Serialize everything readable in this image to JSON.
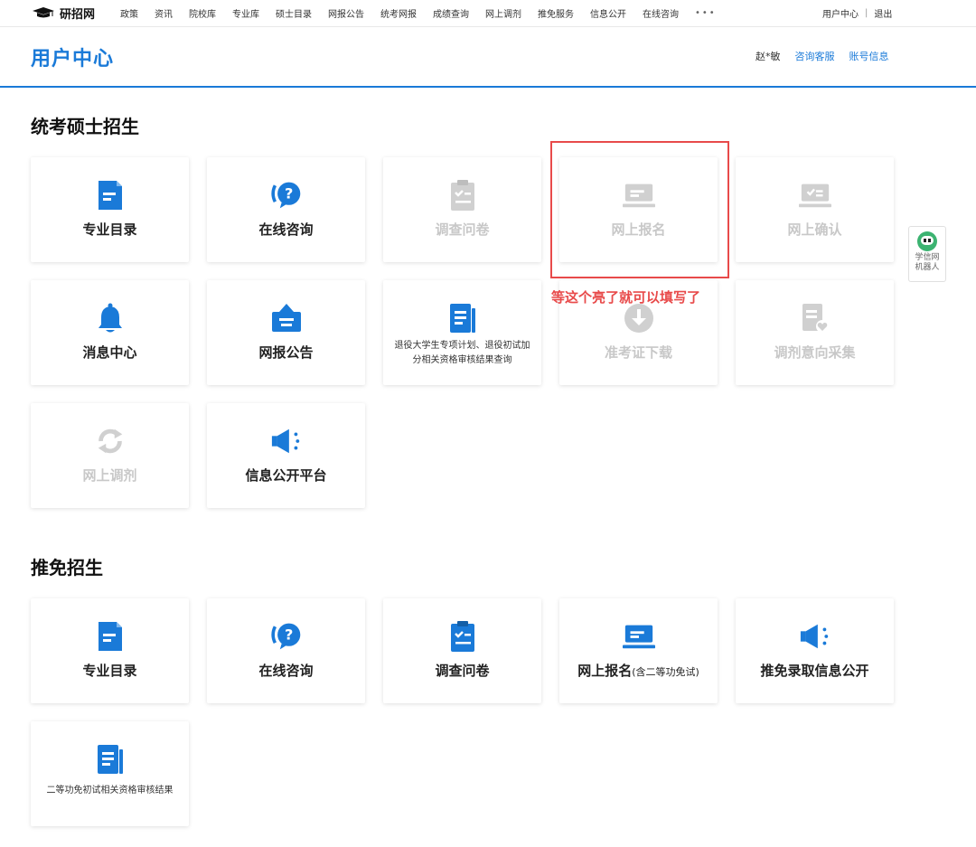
{
  "topnav": {
    "logo": "研招网",
    "items": [
      "政策",
      "资讯",
      "院校库",
      "专业库",
      "硕士目录",
      "网报公告",
      "统考网报",
      "成绩查询",
      "网上调剂",
      "推免服务",
      "信息公开",
      "在线咨询"
    ],
    "more": "•••",
    "user_center": "用户中心",
    "separator": "|",
    "logout": "退出"
  },
  "header": {
    "title": "用户中心",
    "user": "赵*敏",
    "consult": "咨询客服",
    "account": "账号信息"
  },
  "section1": {
    "title": "统考硕士招生",
    "cards": [
      {
        "label": "专业目录",
        "icon": "document-icon",
        "enabled": true
      },
      {
        "label": "在线咨询",
        "icon": "question-bubble-icon",
        "enabled": true
      },
      {
        "label": "调查问卷",
        "icon": "clipboard-check-icon",
        "enabled": false
      },
      {
        "label": "网上报名",
        "icon": "laptop-card-icon",
        "enabled": false
      },
      {
        "label": "网上确认",
        "icon": "screen-check-icon",
        "enabled": false
      },
      {
        "label": "消息中心",
        "icon": "bell-icon",
        "enabled": true
      },
      {
        "label": "网报公告",
        "icon": "announcement-box-icon",
        "enabled": true
      },
      {
        "label": "退役大学生专项计划、退役初试加分相关资格审核结果查询",
        "icon": "list-document-icon",
        "enabled": true
      },
      {
        "label": "准考证下载",
        "icon": "download-icon",
        "enabled": false
      },
      {
        "label": "调剂意向采集",
        "icon": "document-heart-icon",
        "enabled": false
      },
      {
        "label": "网上调剂",
        "icon": "refresh-icon",
        "enabled": false
      },
      {
        "label": "信息公开平台",
        "icon": "megaphone-icon",
        "enabled": true
      }
    ]
  },
  "section2": {
    "title": "推免招生",
    "cards": [
      {
        "label": "专业目录",
        "icon": "document-icon",
        "enabled": true
      },
      {
        "label": "在线咨询",
        "icon": "question-bubble-icon",
        "enabled": true
      },
      {
        "label": "调查问卷",
        "icon": "clipboard-check-icon",
        "enabled": true
      },
      {
        "label": "网上报名",
        "sub": "(含二等功免试)",
        "icon": "laptop-card-icon",
        "enabled": true
      },
      {
        "label": "推免录取信息公开",
        "icon": "megaphone-icon",
        "enabled": true
      },
      {
        "label": "二等功免初试相关资格审核结果",
        "icon": "list-document-icon",
        "enabled": true
      }
    ]
  },
  "annotation": {
    "text": "等这个亮了就可以填写了",
    "color": "#e84a4a"
  },
  "robot": {
    "label": "学信网机器人"
  },
  "colors": {
    "accent": "#1a7ad8",
    "disabled": "#c8c8c8"
  }
}
